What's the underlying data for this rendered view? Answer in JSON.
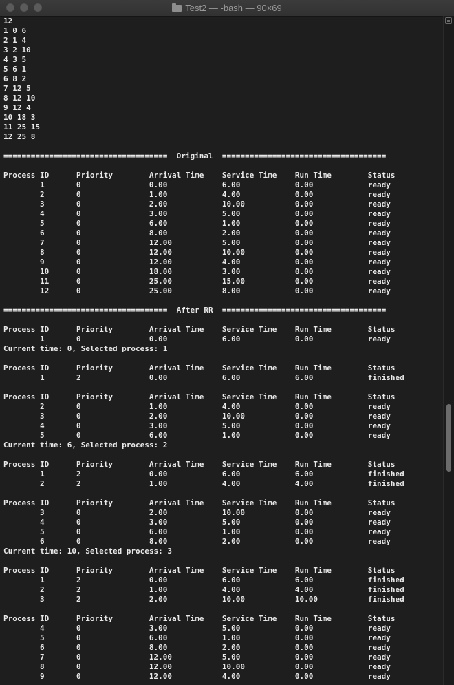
{
  "window": {
    "title": "Test2 — -bash — 90×69",
    "folder_icon": "folder-icon"
  },
  "terminal": {
    "lines": [
      "12",
      "1 0 6",
      "2 1 4",
      "3 2 10",
      "4 3 5",
      "5 6 1",
      "6 8 2",
      "7 12 5",
      "8 12 10",
      "9 12 4",
      "10 18 3",
      "11 25 15",
      "12 25 8",
      "",
      "====================================  Original  ====================================",
      "",
      "Process ID      Priority        Arrival Time    Service Time    Run Time        Status",
      "        1       0               0.00            6.00            0.00            ready",
      "        2       0               1.00            4.00            0.00            ready",
      "        3       0               2.00            10.00           0.00            ready",
      "        4       0               3.00            5.00            0.00            ready",
      "        5       0               6.00            1.00            0.00            ready",
      "        6       0               8.00            2.00            0.00            ready",
      "        7       0               12.00           5.00            0.00            ready",
      "        8       0               12.00           10.00           0.00            ready",
      "        9       0               12.00           4.00            0.00            ready",
      "        10      0               18.00           3.00            0.00            ready",
      "        11      0               25.00           15.00           0.00            ready",
      "        12      0               25.00           8.00            0.00            ready",
      "",
      "====================================  After RR  ====================================",
      "",
      "Process ID      Priority        Arrival Time    Service Time    Run Time        Status",
      "        1       0               0.00            6.00            0.00            ready",
      "Current time: 0, Selected process: 1",
      "",
      "Process ID      Priority        Arrival Time    Service Time    Run Time        Status",
      "        1       2               0.00            6.00            6.00            finished",
      "",
      "Process ID      Priority        Arrival Time    Service Time    Run Time        Status",
      "        2       0               1.00            4.00            0.00            ready",
      "        3       0               2.00            10.00           0.00            ready",
      "        4       0               3.00            5.00            0.00            ready",
      "        5       0               6.00            1.00            0.00            ready",
      "Current time: 6, Selected process: 2",
      "",
      "Process ID      Priority        Arrival Time    Service Time    Run Time        Status",
      "        1       2               0.00            6.00            6.00            finished",
      "        2       2               1.00            4.00            4.00            finished",
      "",
      "Process ID      Priority        Arrival Time    Service Time    Run Time        Status",
      "        3       0               2.00            10.00           0.00            ready",
      "        4       0               3.00            5.00            0.00            ready",
      "        5       0               6.00            1.00            0.00            ready",
      "        6       0               8.00            2.00            0.00            ready",
      "Current time: 10, Selected process: 3",
      "",
      "Process ID      Priority        Arrival Time    Service Time    Run Time        Status",
      "        1       2               0.00            6.00            6.00            finished",
      "        2       2               1.00            4.00            4.00            finished",
      "        3       2               2.00            10.00           10.00           finished",
      "",
      "Process ID      Priority        Arrival Time    Service Time    Run Time        Status",
      "        4       0               3.00            5.00            0.00            ready",
      "        5       0               6.00            1.00            0.00            ready",
      "        6       0               8.00            2.00            0.00            ready",
      "        7       0               12.00           5.00            0.00            ready",
      "        8       0               12.00           10.00           0.00            ready",
      "        9       0               12.00           4.00            0.00            ready"
    ]
  },
  "colors": {
    "background": "#1e1e1e",
    "text": "#e8e8e8",
    "titlebar": "#363636"
  }
}
